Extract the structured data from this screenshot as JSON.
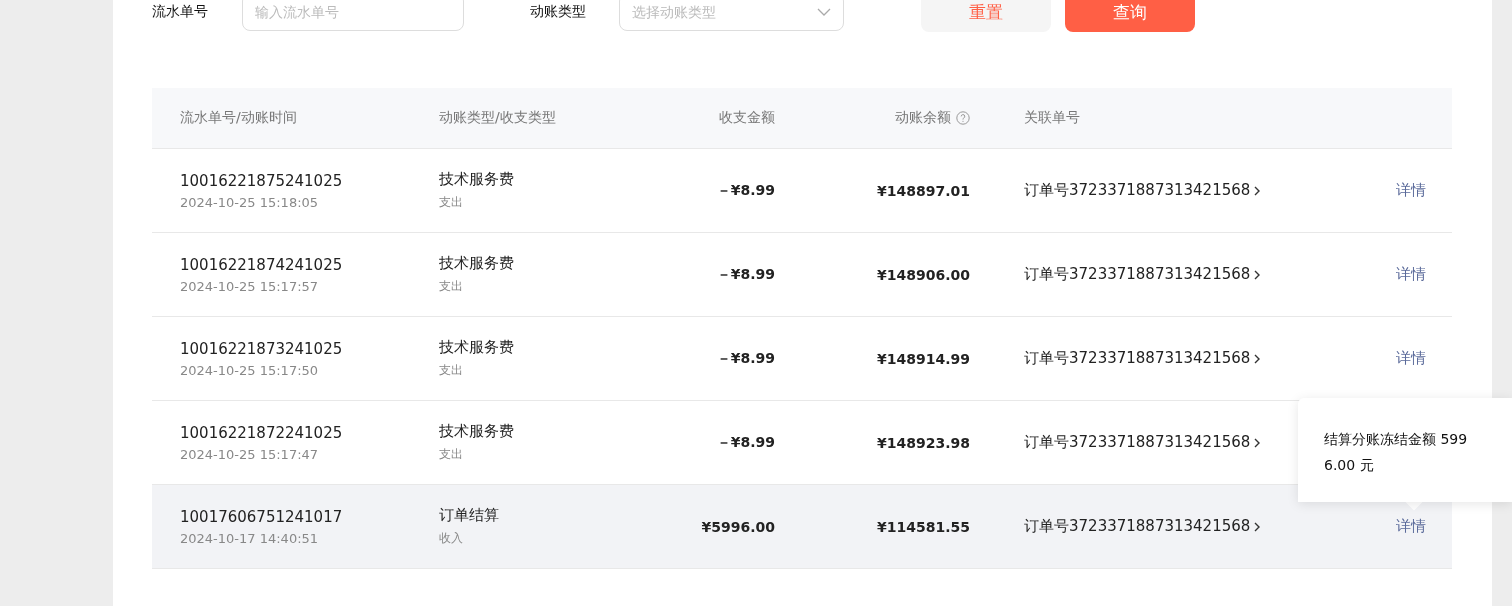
{
  "filters": [
    {
      "label": "流水单号",
      "kind": "input",
      "placeholder": "输入流水单号"
    },
    {
      "label": "动账类型",
      "kind": "select",
      "placeholder": "选择动账类型"
    }
  ],
  "buttons": [
    {
      "label": "重置",
      "kind": "secondary"
    },
    {
      "label": "查询",
      "kind": "primary"
    }
  ],
  "table": {
    "columns": [
      {
        "label": "流水单号/动账时间",
        "help": false
      },
      {
        "label": "动账类型/收支类型",
        "help": false
      },
      {
        "label": "收支金额",
        "help": false
      },
      {
        "label": "动账余额",
        "help": true
      },
      {
        "label": "关联单号",
        "help": false
      }
    ],
    "rows": [
      {
        "serial": "10016221875241025",
        "time": "2024-10-25 15:18:05",
        "type": "技术服务费",
        "direction": "支出",
        "amount": "－¥8.99",
        "balance": "¥148897.01",
        "order": "订单号3723371887313421568",
        "action": "详情",
        "highlighted": false
      },
      {
        "serial": "10016221874241025",
        "time": "2024-10-25 15:17:57",
        "type": "技术服务费",
        "direction": "支出",
        "amount": "－¥8.99",
        "balance": "¥148906.00",
        "order": "订单号3723371887313421568",
        "action": "详情",
        "highlighted": false
      },
      {
        "serial": "10016221873241025",
        "time": "2024-10-25 15:17:50",
        "type": "技术服务费",
        "direction": "支出",
        "amount": "－¥8.99",
        "balance": "¥148914.99",
        "order": "订单号3723371887313421568",
        "action": "详情",
        "highlighted": false
      },
      {
        "serial": "10016221872241025",
        "time": "2024-10-25 15:17:47",
        "type": "技术服务费",
        "direction": "支出",
        "amount": "－¥8.99",
        "balance": "¥148923.98",
        "order": "订单号3723371887313421568",
        "highlighted": false
      },
      {
        "serial": "10017606751241017",
        "time": "2024-10-17 14:40:51",
        "type": "订单结算",
        "direction": "收入",
        "amount": "¥5996.00",
        "balance": "¥114581.55",
        "order": "订单号3723371887313421568",
        "action": "详情",
        "highlighted": true
      }
    ]
  },
  "tooltip": {
    "text": "结算分账冻结金额 5996.00 元"
  }
}
